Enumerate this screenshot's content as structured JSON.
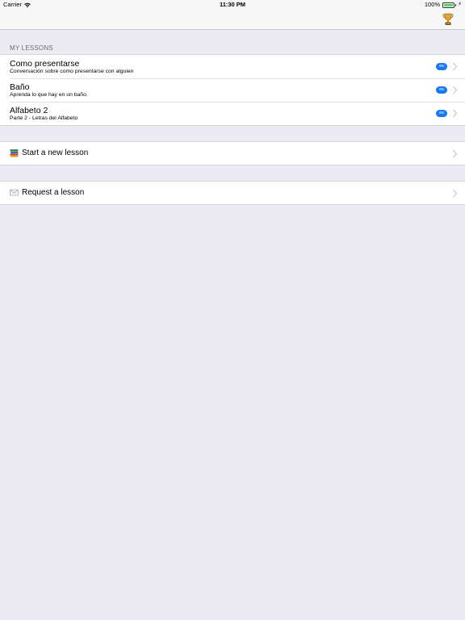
{
  "status_bar": {
    "carrier": "Carrier",
    "time": "11:30 PM",
    "battery": "100%"
  },
  "nav": {
    "right_icon": "trophy-icon"
  },
  "lessons_header": "MY LESSONS",
  "lessons": [
    {
      "title": "Como presentarse",
      "subtitle": "Conversación sobre como presentarse con alguien",
      "lang": "es"
    },
    {
      "title": "Baño",
      "subtitle": "Aprenda lo que hay en un baño.",
      "lang": "es"
    },
    {
      "title": "Alfabeto 2",
      "subtitle": "Parte 2 - Letras del Alfabeto",
      "lang": "es"
    }
  ],
  "actions": {
    "new_lesson": {
      "label": "Start a new lesson",
      "icon": "books-icon"
    },
    "request_lesson": {
      "label": "Request a lesson",
      "icon": "envelope-icon"
    }
  },
  "colors": {
    "background": "#EBEBF1",
    "badge": "#1877F2",
    "battery": "#4CD964"
  }
}
